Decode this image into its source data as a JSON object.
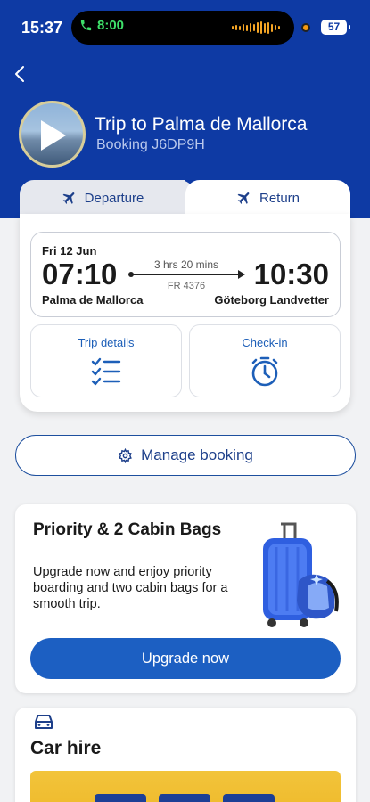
{
  "status_bar": {
    "time": "15:37",
    "call_time": "8:00",
    "battery": "57"
  },
  "trip": {
    "title": "Trip to Palma de Mallorca",
    "booking": "Booking J6DP9H"
  },
  "tabs": [
    {
      "label": "Departure",
      "active": false
    },
    {
      "label": "Return",
      "active": true
    }
  ],
  "flight": {
    "date": "Fri 12 Jun",
    "depart_time": "07:10",
    "arrive_time": "10:30",
    "duration": "3 hrs 20 mins",
    "flight_number": "FR 4376",
    "from": "Palma de Mallorca",
    "to": "Göteborg Landvetter"
  },
  "actions": {
    "trip_details": "Trip details",
    "check_in": "Check-in"
  },
  "manage_booking": "Manage booking",
  "promo": {
    "title": "Priority & 2 Cabin Bags",
    "text": "Upgrade now and enjoy priority boarding and two cabin bags for a smooth trip.",
    "button": "Upgrade now"
  },
  "car_hire": {
    "title": "Car hire"
  },
  "colors": {
    "brand": "#0e3aa4",
    "accent": "#1c5fc2",
    "banner": "#f2c43b"
  },
  "icons": [
    "phone-icon",
    "back-icon",
    "plane-icon",
    "checklist-icon",
    "stopwatch-icon",
    "gear-icon",
    "car-icon"
  ]
}
